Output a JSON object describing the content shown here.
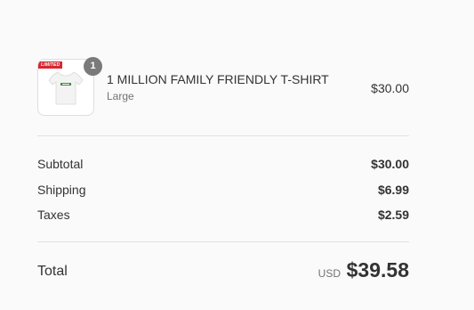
{
  "line_item": {
    "image_tag_text": "LIMITED",
    "quantity": "1",
    "title": "1 MILLION FAMILY FRIENDLY T-SHIRT",
    "variant": "Large",
    "price": "$30.00"
  },
  "totals": {
    "subtotal_label": "Subtotal",
    "subtotal_value": "$30.00",
    "shipping_label": "Shipping",
    "shipping_value": "$6.99",
    "taxes_label": "Taxes",
    "taxes_value": "$2.59",
    "total_label": "Total",
    "currency": "USD",
    "total_value": "$39.58"
  },
  "colors": {
    "background": "#fafafa",
    "text": "#333333",
    "muted_text": "#737373",
    "badge": "#7a7a7a",
    "divider": "#e1e1e1",
    "tag": "#d9262e"
  }
}
